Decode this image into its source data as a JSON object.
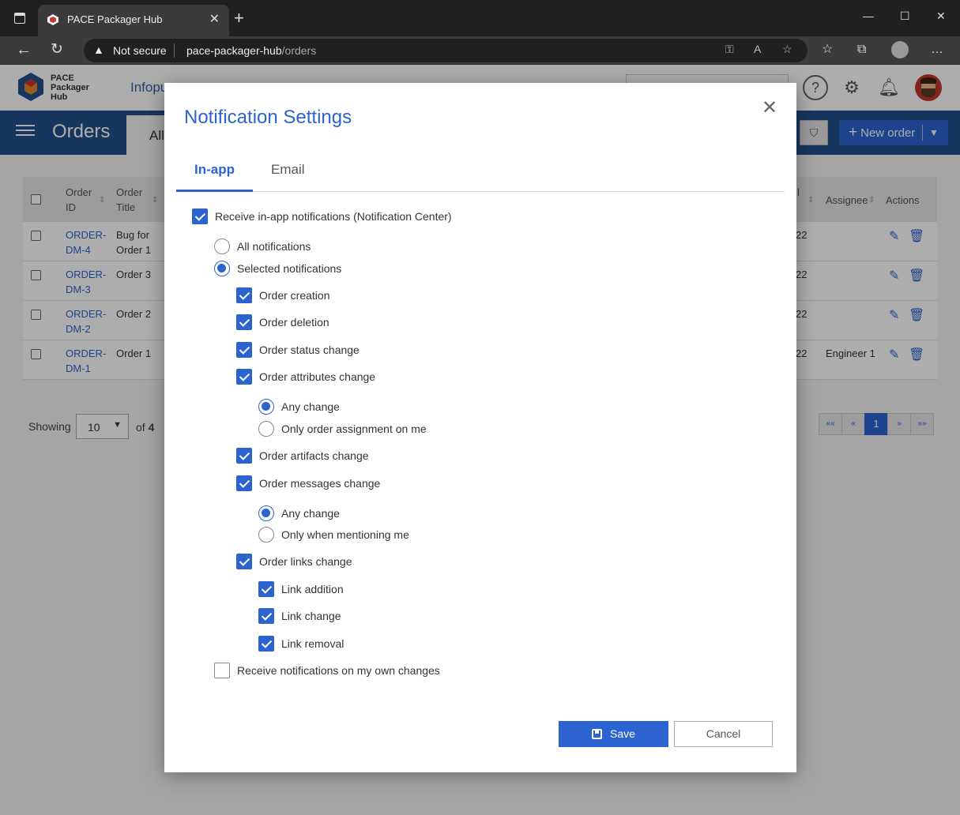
{
  "browser": {
    "tab_title": "PACE Packager Hub",
    "security_label": "Not secure",
    "url_host": "pace-packager-hub",
    "url_path": "/orders"
  },
  "app": {
    "logo_lines": [
      "PACE",
      "Packager",
      "Hub"
    ],
    "nav_partial": "Infopu"
  },
  "orders": {
    "title": "Orders",
    "tab_all": "All",
    "new_order_label": "New order",
    "columns": [
      "Order ID",
      "Order Title",
      "Assignee",
      "Actions"
    ],
    "rows": [
      {
        "id": "ORDER-DM-4",
        "id_l1": "ORDER-",
        "id_l2": "DM-4",
        "title_l1": "Bug for",
        "title_l2": "Order 1",
        "date_frag": "22",
        "assignee": ""
      },
      {
        "id": "ORDER-DM-3",
        "id_l1": "ORDER-",
        "id_l2": "DM-3",
        "title_l1": "Order 3",
        "title_l2": "",
        "date_frag": "22",
        "assignee": ""
      },
      {
        "id": "ORDER-DM-2",
        "id_l1": "ORDER-",
        "id_l2": "DM-2",
        "title_l1": "Order 2",
        "title_l2": "",
        "date_frag": "22",
        "assignee": ""
      },
      {
        "id": "ORDER-DM-1",
        "id_l1": "ORDER-",
        "id_l2": "DM-1",
        "title_l1": "Order 1",
        "title_l2": "",
        "date_frag": "22",
        "assignee": "Engineer 1"
      }
    ],
    "footer": {
      "showing_label": "Showing",
      "page_size": "10",
      "of_label": "of",
      "total": "4",
      "pager": [
        "««",
        "«",
        "1",
        "»",
        "»»"
      ]
    }
  },
  "modal": {
    "title": "Notification Settings",
    "tabs": [
      "In-app",
      "Email"
    ],
    "active_tab": "In-app",
    "options": {
      "receive_inapp": {
        "label": "Receive in-app notifications (Notification Center)",
        "checked": true
      },
      "all_notifications": {
        "label": "All notifications",
        "selected": false
      },
      "selected_notifications": {
        "label": "Selected notifications",
        "selected": true
      },
      "order_creation": {
        "label": "Order creation",
        "checked": true
      },
      "order_deletion": {
        "label": "Order deletion",
        "checked": true
      },
      "order_status_change": {
        "label": "Order status change",
        "checked": true
      },
      "order_attributes_change": {
        "label": "Order attributes change",
        "checked": true
      },
      "attr_any_change": {
        "label": "Any change",
        "selected": true
      },
      "attr_only_assignment": {
        "label": "Only order assignment on me",
        "selected": false
      },
      "order_artifacts_change": {
        "label": "Order artifacts change",
        "checked": true
      },
      "order_messages_change": {
        "label": "Order messages change",
        "checked": true
      },
      "msg_any_change": {
        "label": "Any change",
        "selected": true
      },
      "msg_only_mention": {
        "label": "Only when mentioning me",
        "selected": false
      },
      "order_links_change": {
        "label": "Order links change",
        "checked": true
      },
      "link_addition": {
        "label": "Link addition",
        "checked": true
      },
      "link_change": {
        "label": "Link change",
        "checked": true
      },
      "link_removal": {
        "label": "Link removal",
        "checked": true
      },
      "own_changes": {
        "label": "Receive notifications on my own changes",
        "checked": false
      }
    },
    "save_label": "Save",
    "cancel_label": "Cancel"
  },
  "colors": {
    "accent": "#2b64d0",
    "header_bar": "#23508a"
  }
}
